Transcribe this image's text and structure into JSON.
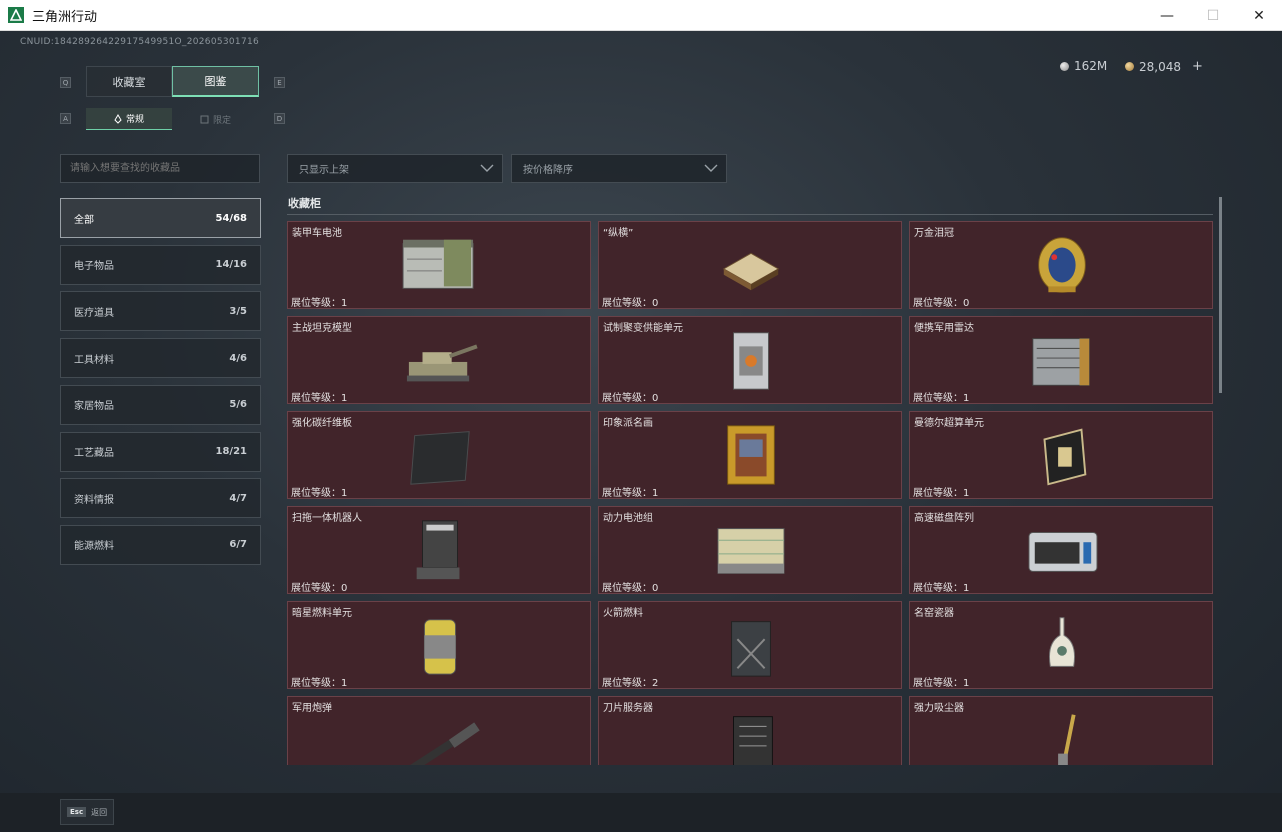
{
  "window": {
    "title": "三角洲行动",
    "min": "—",
    "max": "☐",
    "close": "✕"
  },
  "uid": "CNUID:18428926422917549951O_202605301716",
  "currency": {
    "silver": "162M",
    "gold": "28,048",
    "plus": "+"
  },
  "keys": {
    "left1": "Q",
    "right1": "E",
    "left2": "A",
    "right2": "D"
  },
  "tabs": {
    "collection": "收藏室",
    "catalog": "图鉴"
  },
  "subtabs": {
    "normal": "常规",
    "limited": "限定"
  },
  "search": {
    "placeholder": "请输入想要查找的收藏品"
  },
  "filters": {
    "show": "只显示上架",
    "sort": "按价格降序"
  },
  "categories": [
    {
      "label": "全部",
      "count": "54/68"
    },
    {
      "label": "电子物品",
      "count": "14/16"
    },
    {
      "label": "医疗道具",
      "count": "3/5"
    },
    {
      "label": "工具材料",
      "count": "4/6"
    },
    {
      "label": "家居物品",
      "count": "5/6"
    },
    {
      "label": "工艺藏品",
      "count": "18/21"
    },
    {
      "label": "资料情报",
      "count": "4/7"
    },
    {
      "label": "能源燃料",
      "count": "6/7"
    }
  ],
  "section": {
    "title": "收藏柜"
  },
  "items": [
    {
      "name": "装甲车电池",
      "level": "展位等级：1",
      "icon": "battery-icon"
    },
    {
      "name": "“纵横”",
      "level": "展位等级：0",
      "icon": "chessboard-icon"
    },
    {
      "name": "万金泪冠",
      "level": "展位等级：0",
      "icon": "jeweled-egg-icon"
    },
    {
      "name": "主战坦克模型",
      "level": "展位等级：1",
      "icon": "tank-icon"
    },
    {
      "name": "试制聚变供能单元",
      "level": "展位等级：0",
      "icon": "fusion-cell-icon"
    },
    {
      "name": "便携军用雷达",
      "level": "展位等级：1",
      "icon": "radar-icon"
    },
    {
      "name": "强化碳纤维板",
      "level": "展位等级：1",
      "icon": "carbon-plate-icon"
    },
    {
      "name": "印象派名画",
      "level": "展位等级：1",
      "icon": "painting-icon"
    },
    {
      "name": "曼德尔超算单元",
      "level": "展位等级：1",
      "icon": "supercomputer-icon"
    },
    {
      "name": "扫拖一体机器人",
      "level": "展位等级：0",
      "icon": "robot-vacuum-icon"
    },
    {
      "name": "动力电池组",
      "level": "展位等级：0",
      "icon": "battery-pack-icon"
    },
    {
      "name": "高速磁盘阵列",
      "level": "展位等级：1",
      "icon": "disk-array-icon"
    },
    {
      "name": "暗星燃料单元",
      "level": "展位等级：1",
      "icon": "fuel-canister-icon"
    },
    {
      "name": "火箭燃料",
      "level": "展位等级：2",
      "icon": "jerrycan-icon"
    },
    {
      "name": "名窑瓷器",
      "level": "展位等级：1",
      "icon": "porcelain-vase-icon"
    },
    {
      "name": "军用炮弹",
      "level": "",
      "icon": "shell-icon"
    },
    {
      "name": "刀片服务器",
      "level": "",
      "icon": "server-icon"
    },
    {
      "name": "强力吸尘器",
      "level": "",
      "icon": "vacuum-cleaner-icon"
    }
  ],
  "bottom": {
    "esc_key": "Esc",
    "esc_label": "返回"
  }
}
